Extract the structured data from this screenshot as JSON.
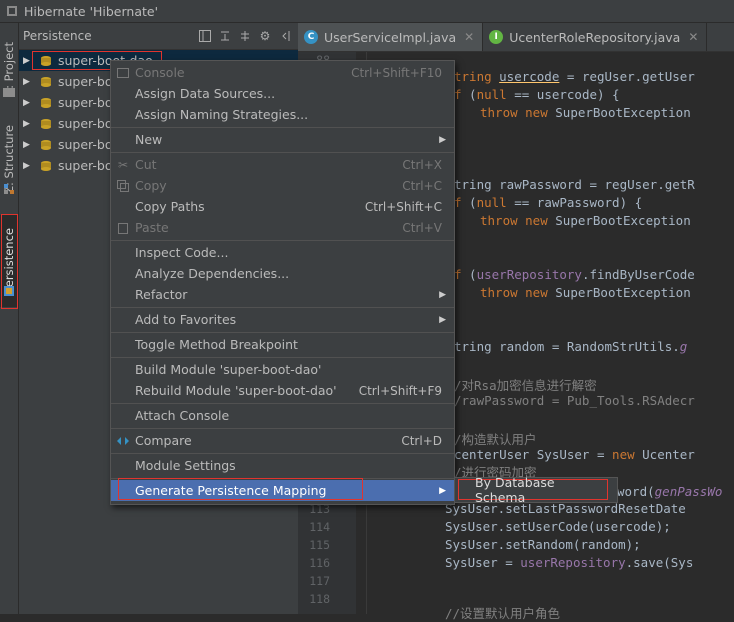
{
  "window": {
    "title": "Hibernate 'Hibernate'"
  },
  "sidebar": {
    "tabs": [
      {
        "label": "1: Project"
      },
      {
        "label": "Z: Structure"
      },
      {
        "label": "Persistence"
      }
    ]
  },
  "panel": {
    "title": "Persistence",
    "tree": [
      {
        "label": "super-boot-dao"
      },
      {
        "label": "super-boo"
      },
      {
        "label": "super-boo"
      },
      {
        "label": "super-boo"
      },
      {
        "label": "super-boo"
      },
      {
        "label": "super-boo"
      }
    ]
  },
  "editor": {
    "tabs": [
      {
        "icon": "C",
        "name": "UserServiceImpl.java",
        "color": "#3592c4"
      },
      {
        "icon": "I",
        "name": "UcenterRoleRepository.java",
        "color": "#62b543"
      }
    ],
    "line_numbers": [
      "88",
      "113",
      "114",
      "115",
      "116",
      "117",
      "118"
    ],
    "code": {
      "l1a": "tring ",
      "l1b": "usercode",
      "l1c": " = regUser.getUser",
      "l2a": "f",
      "l2b": " (",
      "l2c": "null",
      "l2d": " == usercode) {",
      "l3a": "throw new ",
      "l3b": "SuperBootException",
      "l4a": "tring rawPassword = regUser.getR",
      "l5a": "f",
      "l5b": " (",
      "l5c": "null",
      "l5d": " == rawPassword) {",
      "l6a": "throw new ",
      "l6b": "SuperBootException",
      "l7a": "f",
      "l7b": " (",
      "l7c": "userRepository",
      "l7d": ".findByUserCode",
      "l8a": "throw new ",
      "l8b": "SuperBootException",
      "l9a": "tring random = RandomStrUtils.",
      "l9b": "g",
      "l10a": "/对Rsa加密信息进行解密",
      "l11a": "/rawPassword = Pub_Tools.RSAdecr",
      "l12a": "/构造默认用户",
      "l13a": "centerUser SysUser = ",
      "l13b": "new ",
      "l13c": "Ucenter",
      "l14a": "/进行密码加密",
      "l15a": "word(",
      "l15b": "genPassWo",
      "l16a": "SysUser.setLastPasswordResetDate",
      "l17a": "SysUser.setUserCode(usercode);",
      "l18a": "SysUser.setRandom(random);",
      "l19a": "SysUser = ",
      "l19b": "userRepository",
      "l19c": ".save(Sys",
      "l20a": "//设置默认用户角色"
    }
  },
  "context_menu": {
    "items": [
      {
        "label": "Console",
        "shortcut": "Ctrl+Shift+F10"
      },
      {
        "label": "Assign Data Sources..."
      },
      {
        "label": "Assign Naming Strategies..."
      },
      {
        "label": "New"
      },
      {
        "label": "Cut",
        "shortcut": "Ctrl+X"
      },
      {
        "label": "Copy",
        "shortcut": "Ctrl+C"
      },
      {
        "label": "Copy Paths",
        "shortcut": "Ctrl+Shift+C"
      },
      {
        "label": "Paste",
        "shortcut": "Ctrl+V"
      },
      {
        "label": "Inspect Code..."
      },
      {
        "label": "Analyze Dependencies..."
      },
      {
        "label": "Refactor"
      },
      {
        "label": "Add to Favorites"
      },
      {
        "label": "Toggle Method Breakpoint"
      },
      {
        "label": "Build Module 'super-boot-dao'"
      },
      {
        "label": "Rebuild Module 'super-boot-dao'",
        "shortcut": "Ctrl+Shift+F9"
      },
      {
        "label": "Attach Console"
      },
      {
        "label": "Compare",
        "shortcut": "Ctrl+D"
      },
      {
        "label": "Module Settings"
      },
      {
        "label": "Generate Persistence Mapping"
      }
    ]
  },
  "submenu": {
    "label": "By Database Schema"
  },
  "colors": {
    "accent": "#4b6eaf",
    "annotation": "#e0342e",
    "background": "#2b2b2b"
  }
}
